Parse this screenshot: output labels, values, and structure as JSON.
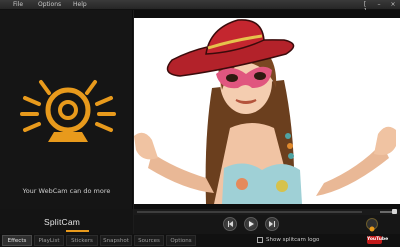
{
  "menu": {
    "file": "File",
    "options": "Options",
    "help": "Help"
  },
  "window": {
    "restore_icon": "[ ]",
    "minimize_icon": "–",
    "close_icon": "×"
  },
  "left_panel": {
    "tagline": "Your WebCam can do more",
    "brand": "SplitCam"
  },
  "tabs": [
    {
      "label": "Effects",
      "active": true
    },
    {
      "label": "PlayList",
      "active": false
    },
    {
      "label": "Stickers",
      "active": false
    },
    {
      "label": "Snapshot",
      "active": false
    },
    {
      "label": "Sources",
      "active": false
    },
    {
      "label": "Options",
      "active": false
    }
  ],
  "show_logo": {
    "label": "Show splitcam logo",
    "checked": false
  },
  "youtube_badge": "YouTube",
  "icons": {
    "webcam": "webcam-icon",
    "prev": "previous-icon",
    "play": "play-icon",
    "next": "next-icon",
    "snapshot": "snapshot-icon"
  },
  "colors": {
    "accent": "#e89a1c",
    "panel": "#151515",
    "tab_active": "#2f2f2f"
  },
  "volume": {
    "level": 0.65
  }
}
